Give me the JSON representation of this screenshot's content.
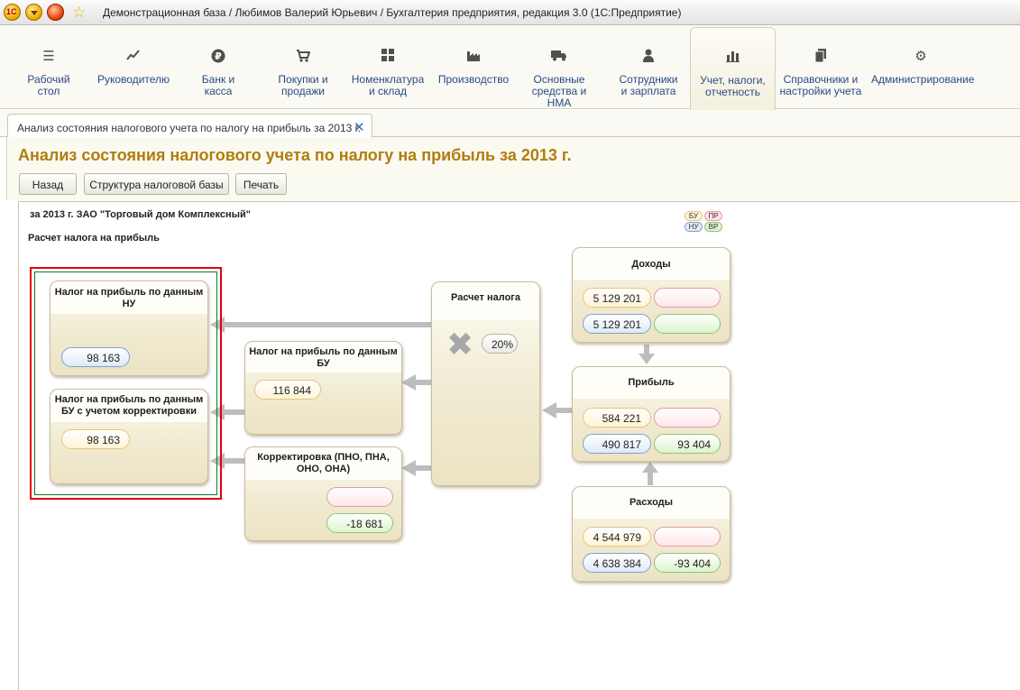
{
  "window": {
    "title": "Демонстрационная база / Любимов Валерий Юрьевич / Бухгалтерия предприятия, редакция 3.0  (1С:Предприятие)"
  },
  "sections": [
    {
      "label": "Рабочий стол",
      "icon": "list-icon"
    },
    {
      "label": "Руководителю",
      "icon": "trend-icon"
    },
    {
      "label": "Банк и касса",
      "icon": "ruble-icon"
    },
    {
      "label": "Покупки и продажи",
      "icon": "cart-icon"
    },
    {
      "label": "Номенклатура и склад",
      "icon": "grid-icon"
    },
    {
      "label": "Производство",
      "icon": "factory-icon"
    },
    {
      "label": "Основные средства и НМА",
      "icon": "truck-icon"
    },
    {
      "label": "Сотрудники и зарплата",
      "icon": "person-icon"
    },
    {
      "label": "Учет, налоги, отчетность",
      "icon": "bar-chart-icon"
    },
    {
      "label": "Справочники и настройки учета",
      "icon": "documents-icon"
    },
    {
      "label": "Администрирование",
      "icon": "gear-icon"
    }
  ],
  "tab": {
    "label": "Анализ состояния налогового учета по налогу на прибыль за 2013 г.",
    "close_glyph": "✕"
  },
  "form": {
    "title": "Анализ состояния налогового учета по налогу на прибыль за 2013 г.",
    "buttons": {
      "back": "Назад",
      "structure": "Структура налоговой базы",
      "print": "Печать"
    }
  },
  "report": {
    "org_line": "за 2013 г. ЗАО \"Торговый дом Комплексный\"",
    "section_title": "Расчет налога на прибыль",
    "legend": {
      "bu": "БУ",
      "pr": "ПР",
      "nu": "НУ",
      "vr": "ВР"
    },
    "boxes": {
      "tax_nu": {
        "title": "Налог на прибыль по данным НУ",
        "nu": "98 163"
      },
      "tax_bu_adj": {
        "title": "Налог на прибыль по данным БУ с учетом корректировки",
        "bu": "98 163"
      },
      "tax_bu": {
        "title": "Налог на прибыль по данным БУ",
        "bu": "116 844"
      },
      "adjustment": {
        "title": "Корректировка (ПНО, ПНА, ОНО, ОНА)",
        "pr": "",
        "vr": "-18 681"
      },
      "calc": {
        "title": "Расчет налога",
        "rate": "20%"
      },
      "income": {
        "title": "Доходы",
        "bu": "5 129 201",
        "pr": "",
        "nu": "5 129 201",
        "vr": ""
      },
      "profit": {
        "title": "Прибыль",
        "bu": "584 221",
        "pr": "",
        "nu": "490 817",
        "vr": "93 404"
      },
      "expenses": {
        "title": "Расходы",
        "bu": "4 544 979",
        "pr": "",
        "nu": "4 638 384",
        "vr": "-93 404"
      }
    }
  },
  "colors": {
    "title": "#b07d10",
    "section_link": "#2a4a85",
    "highlight": "#e2000f"
  }
}
